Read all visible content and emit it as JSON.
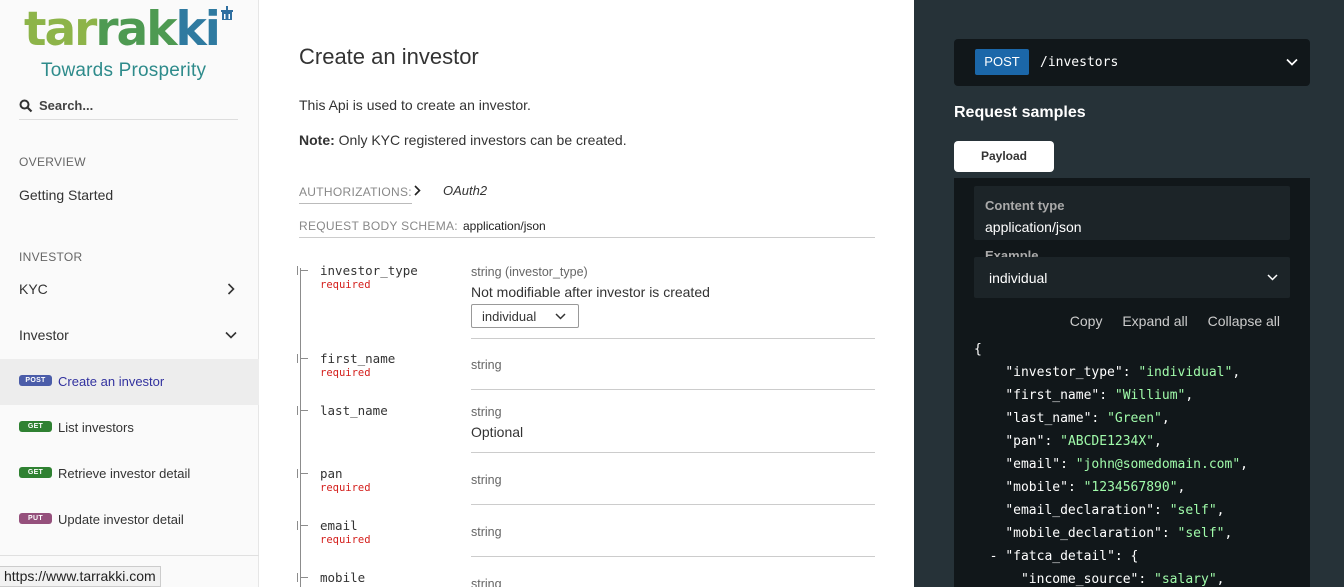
{
  "sidebar": {
    "logo_text": "tarrakki",
    "logo_tagline": "Towards Prosperity",
    "search_placeholder": "Search...",
    "sections": [
      {
        "label": "OVERVIEW"
      },
      {
        "label": "INVESTOR"
      }
    ],
    "overview_items": [
      {
        "label": "Getting Started"
      }
    ],
    "investor_groups": [
      {
        "label": "KYC",
        "expanded": false
      },
      {
        "label": "Investor",
        "expanded": true
      }
    ],
    "operations": [
      {
        "method": "POST",
        "label": "Create an investor",
        "color": "#4b5da9",
        "active": true
      },
      {
        "method": "GET",
        "label": "List investors",
        "color": "#2f8132",
        "active": false
      },
      {
        "method": "GET",
        "label": "Retrieve investor detail",
        "color": "#2f8132",
        "active": false
      },
      {
        "method": "PUT",
        "label": "Update investor detail",
        "color": "#95507c",
        "active": false
      }
    ],
    "status_url": "https://www.tarrakki.com"
  },
  "main": {
    "title": "Create an investor",
    "description": "This Api is used to create an investor.",
    "note_label": "Note:",
    "note_text": " Only KYC registered investors can be created.",
    "authorizations_label": "AUTHORIZATIONS:",
    "authorizations_value": "OAuth2",
    "request_body_label": "REQUEST BODY SCHEMA:",
    "request_body_value": "application/json",
    "fields": [
      {
        "name": "investor_type",
        "required": "required",
        "type": "string (investor_type)",
        "description": "Not modifiable after investor is created",
        "enum_value": "individual"
      },
      {
        "name": "first_name",
        "required": "required",
        "type": "string",
        "description": ""
      },
      {
        "name": "last_name",
        "required": "",
        "type": "string",
        "description": "Optional"
      },
      {
        "name": "pan",
        "required": "required",
        "type": "string",
        "description": ""
      },
      {
        "name": "email",
        "required": "required",
        "type": "string",
        "description": ""
      },
      {
        "name": "mobile",
        "required": "",
        "type": "string",
        "description": ""
      }
    ]
  },
  "right_panel": {
    "method": "POST",
    "path": "/investors",
    "request_samples_title": "Request samples",
    "tab_label": "Payload",
    "content_type_label": "Content type",
    "content_type_value": "application/json",
    "example_label": "Example",
    "example_value": "individual",
    "tools": [
      "Copy",
      "Expand all",
      "Collapse all"
    ],
    "payload_lines": [
      {
        "key": "investor_type",
        "value": "individual"
      },
      {
        "key": "first_name",
        "value": "Willium"
      },
      {
        "key": "last_name",
        "value": "Green"
      },
      {
        "key": "pan",
        "value": "ABCDE1234X"
      },
      {
        "key": "email",
        "value": "john@somedomain.com"
      },
      {
        "key": "mobile",
        "value": "1234567890"
      },
      {
        "key": "email_declaration",
        "value": "self"
      },
      {
        "key": "mobile_declaration",
        "value": "self"
      }
    ],
    "nested_key": "fatca_detail",
    "nested_first": {
      "key": "income_source",
      "value": "salary"
    }
  },
  "colors": {
    "accent": "#32329f",
    "panel_bg": "#263238",
    "code_string": "#a0fbaa",
    "required": "#d41f1c",
    "post_badge": "#1b67a9"
  }
}
